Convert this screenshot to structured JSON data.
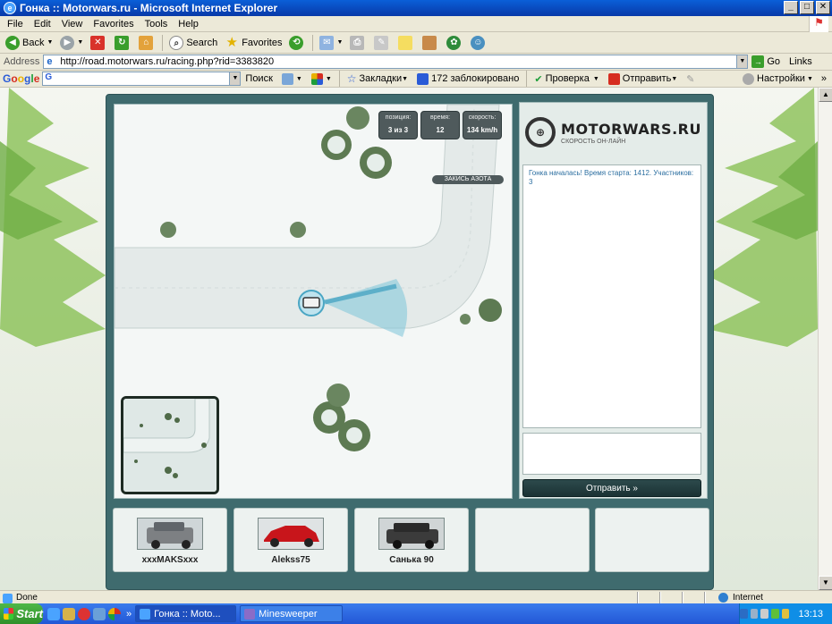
{
  "window": {
    "title": "Гонка :: Motorwars.ru - Microsoft Internet Explorer",
    "min": "_",
    "max": "□",
    "close": "✕"
  },
  "menu": [
    "File",
    "Edit",
    "View",
    "Favorites",
    "Tools",
    "Help"
  ],
  "toolbar": {
    "back": "Back",
    "search": "Search",
    "favorites": "Favorites"
  },
  "address": {
    "label": "Address",
    "url": "http://road.motorwars.ru/racing.php?rid=3383820",
    "go": "Go",
    "links": "Links"
  },
  "googlebar": {
    "logo": "Google",
    "search_btn": "Поиск",
    "bookmarks": "Закладки",
    "blocked": "172 заблокировано",
    "check": "Проверка",
    "send": "Отправить",
    "settings": "Настройки"
  },
  "hud": {
    "position_label": "позиция:",
    "position_value": "3 из 3",
    "time_label": "время:",
    "time_value": "12",
    "speed_label": "скорость:",
    "speed_value": "134 km/h",
    "nitro": "ЗАКИСЬ АЗОТА"
  },
  "logo": {
    "text": "MOTORWARS.RU",
    "subtitle": "СКОРОСТЬ ОН-ЛАЙН"
  },
  "chat": {
    "message": "Гонка началась! Время старта: 1412. Участников: 3",
    "send_button": "Отправить »"
  },
  "players": [
    {
      "name": "xxxMAKSxxx",
      "car_color": "#7d8083"
    },
    {
      "name": "Alekss75",
      "car_color": "#c8151b"
    },
    {
      "name": "Санька 90",
      "car_color": "#3b3b3b"
    }
  ],
  "status": {
    "done": "Done",
    "zone": "Internet"
  },
  "taskbar": {
    "start": "Start",
    "task1": "Гонка :: Moto...",
    "task2": "Minesweeper",
    "clock": "13:13"
  }
}
